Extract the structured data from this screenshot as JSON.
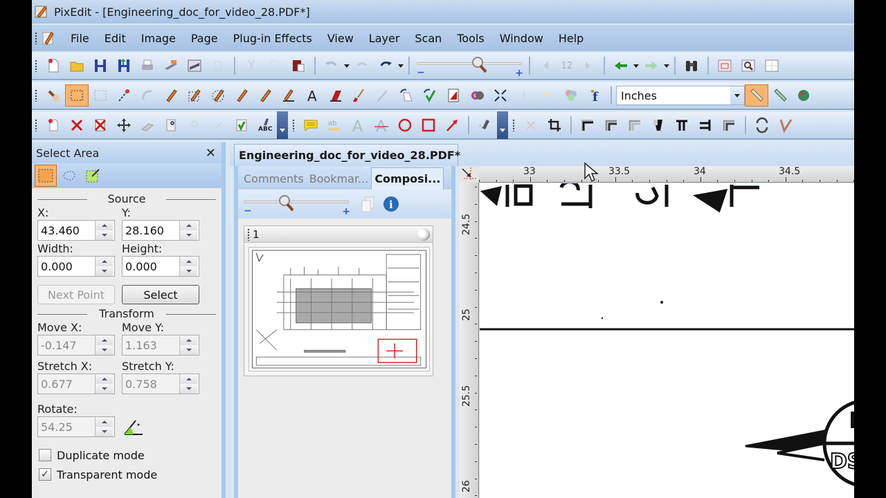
{
  "window": {
    "title": "PixEdit - [Engineering_doc_for_video_28.PDF*]"
  },
  "menu": {
    "items": [
      "File",
      "Edit",
      "Image",
      "Page",
      "Plug-in Effects",
      "View",
      "Layer",
      "Scan",
      "Tools",
      "Window",
      "Help"
    ]
  },
  "toolbar1": {
    "icons": [
      "new-document-icon",
      "open-folder-icon",
      "save-icon",
      "save-as-icon",
      "print-icon",
      "scan-icon",
      "acquire-icon",
      "paste-disabled-icon",
      "cut-icon",
      "copy-icon",
      "paste-icon",
      "undo-icon",
      "undo-repeat-icon",
      "redo-icon",
      "zoom-slider",
      "previous-page-icon",
      "next-page-icon",
      "back-icon",
      "forward-icon",
      "find-icon",
      "view-window-icon",
      "magnify-window-icon",
      "thumbnail-view-icon"
    ],
    "page_number": "12",
    "zoom_level_fraction": 0.62
  },
  "toolbar2": {
    "units": {
      "selected": "Inches"
    }
  },
  "toolbar3": {
    "text_tool_label_a": "A",
    "text_tool_label_b": "A"
  },
  "select_area": {
    "title": "Select Area",
    "close_label": "✕",
    "source": {
      "title": "Source",
      "x_label": "X:",
      "x_value": "43.460",
      "y_label": "Y:",
      "y_value": "28.160",
      "width_label": "Width:",
      "width_value": "0.000",
      "height_label": "Height:",
      "height_value": "0.000"
    },
    "buttons": {
      "next_point": "Next Point",
      "select": "Select"
    },
    "transform": {
      "title": "Transform",
      "move_x_label": "Move X:",
      "move_x_value": "-0.147",
      "move_y_label": "Move Y:",
      "move_y_value": "1.163",
      "stretch_x_label": "Stretch X:",
      "stretch_x_value": "0.677",
      "stretch_y_label": "Stretch Y:",
      "stretch_y_value": "0.758",
      "rotate_label": "Rotate:",
      "rotate_value": "54.25"
    },
    "options": {
      "duplicate_mode": {
        "label": "Duplicate mode",
        "checked": false
      },
      "transparent_mode": {
        "label": "Transparent mode",
        "checked": true
      }
    }
  },
  "document": {
    "tab_label": "Engineering_doc_for_video_28.PDF*"
  },
  "composition_panel": {
    "tabs": [
      {
        "label": "Comments",
        "active": false
      },
      {
        "label": "Bookmar...",
        "active": false
      },
      {
        "label": "Composi...",
        "active": true
      }
    ],
    "zoom_minus": "−",
    "zoom_plus": "+",
    "page_card": {
      "page_number": "1"
    }
  },
  "rulers": {
    "units": "inches",
    "horizontal_labels": [
      "33",
      "33.5",
      "34",
      "34.5"
    ],
    "vertical_labels": [
      "24.5",
      "25",
      "25.5",
      "26"
    ]
  },
  "colors": {
    "accent_active": "#f9b46e",
    "panel_border": "#a9c8ec",
    "selection_box": "#e02020"
  }
}
